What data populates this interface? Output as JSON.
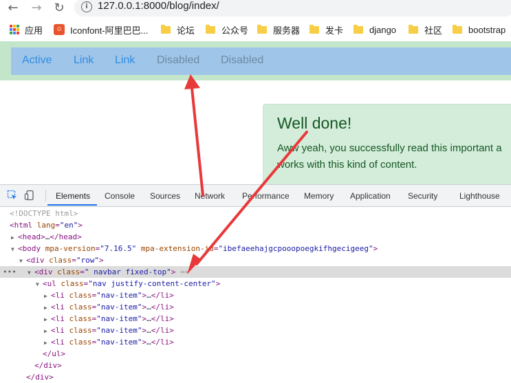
{
  "browser": {
    "back_glyph": "←",
    "forward_glyph": "→",
    "reload_glyph": "↻",
    "info_glyph": "i",
    "url": "127.0.0.1:8000/blog/index/"
  },
  "bookmarks": [
    {
      "label": "应用",
      "icon": "apps-grid-icon"
    },
    {
      "label": "Iconfont-阿里巴巴...",
      "icon": "iconfont-icon"
    },
    {
      "label": "论坛",
      "icon": "folder-icon"
    },
    {
      "label": "公众号",
      "icon": "folder-icon"
    },
    {
      "label": "服务器",
      "icon": "folder-icon"
    },
    {
      "label": "发卡",
      "icon": "folder-icon"
    },
    {
      "label": "django",
      "icon": "folder-icon"
    },
    {
      "label": "社区",
      "icon": "folder-icon"
    },
    {
      "label": "bootstrap",
      "icon": "folder-icon"
    }
  ],
  "navbar": {
    "items": [
      {
        "label": "Active",
        "state": "active"
      },
      {
        "label": "Link",
        "state": "link"
      },
      {
        "label": "Link",
        "state": "link"
      },
      {
        "label": "Disabled",
        "state": "disabled"
      },
      {
        "label": "Disabled",
        "state": "disabled"
      }
    ]
  },
  "alert": {
    "heading": "Well done!",
    "text_line1": "Aww yeah, you successfully read this important a",
    "text_line2": "works with this kind of content."
  },
  "devtools": {
    "tabs": [
      "Elements",
      "Console",
      "Sources",
      "Network",
      "Performance",
      "Memory",
      "Application",
      "Security",
      "Lighthouse"
    ],
    "selected_tab": "Elements",
    "selected_marker": "==",
    "dom": {
      "doctype": "<!DOCTYPE html>",
      "html_open": {
        "tag": "<html",
        "attr": "lang",
        "val": "\"en\"",
        "close": ">"
      },
      "head": {
        "open": "<head>",
        "ellipsis": "…",
        "close": "</head>"
      },
      "body": {
        "tag": "<body",
        "a1": "mpa-version",
        "v1": "\"7.16.5\"",
        "a2": "mpa-extension-id",
        "v2": "\"ibefaeehajgcpooopoegkifhgecigeeg\"",
        "close": ">"
      },
      "row": {
        "tag": "<div",
        "attr": "class",
        "val": "\"row\"",
        "close": ">"
      },
      "navbar_div": {
        "tag": "<div",
        "attr": "class",
        "val": "\" navbar fixed-top\"",
        "close": ">"
      },
      "ul": {
        "tag": "<ul",
        "attr": "class",
        "val": "\"nav justify-content-center\"",
        "close": ">"
      },
      "li": {
        "tag": "<li",
        "attr": "class",
        "val": "\"nav-item\"",
        "close": ">",
        "ellipsis": "…",
        "end": "</li>"
      },
      "ul_close": "</ul>",
      "div_close": "</div>"
    }
  },
  "colors": {
    "row_bg": "#c3e6cb",
    "navbar_bg": "#9fc5e8",
    "alert_bg": "#d4edda",
    "alert_text": "#155724",
    "arrow": "#e8393a"
  }
}
